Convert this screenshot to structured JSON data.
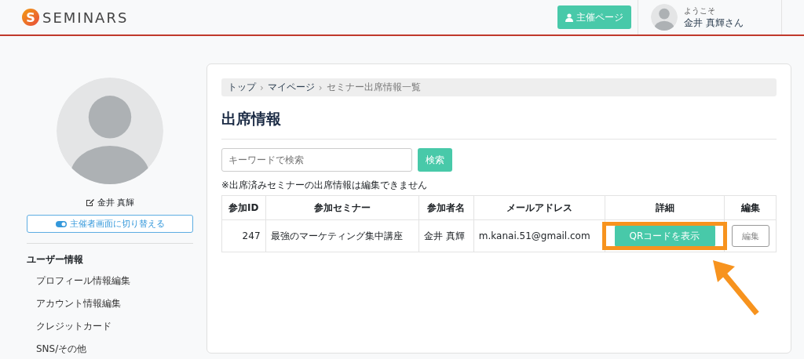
{
  "header": {
    "logo_mark": "S",
    "logo_text": "SEMINARS",
    "organizer_button": "主催ページ",
    "welcome": "ようこそ",
    "user_name": "金井 真輝さん"
  },
  "sidebar": {
    "name": "金井 真輝",
    "switch_button": "主催者画面に切り替える",
    "section_title": "ユーザー情報",
    "items": [
      {
        "label": "プロフィール情報編集"
      },
      {
        "label": "アカウント情報編集"
      },
      {
        "label": "クレジットカード"
      },
      {
        "label": "SNS/その他"
      }
    ]
  },
  "breadcrumb": {
    "separator": "›",
    "items": [
      {
        "label": "トップ",
        "kind": "link"
      },
      {
        "label": "マイページ",
        "kind": "link"
      },
      {
        "label": "セミナー出席情報一覧",
        "kind": "current"
      }
    ]
  },
  "title": "出席情報",
  "search": {
    "placeholder": "キーワードで検索",
    "button": "検索"
  },
  "note": "※出席済みセミナーの出席情報は編集できません",
  "table": {
    "columns": [
      "参加ID",
      "参加セミナー",
      "参加者名",
      "メールアドレス",
      "詳細",
      "編集"
    ],
    "rows": [
      {
        "id": "247",
        "seminar": "最強のマーケティング集中講座",
        "participant": "金井 真輝",
        "email": "m.kanai.51@gmail.com",
        "detail_button": "QRコードを表示",
        "edit_button": "編集",
        "edit_disabled": true,
        "highlighted": true
      }
    ]
  }
}
